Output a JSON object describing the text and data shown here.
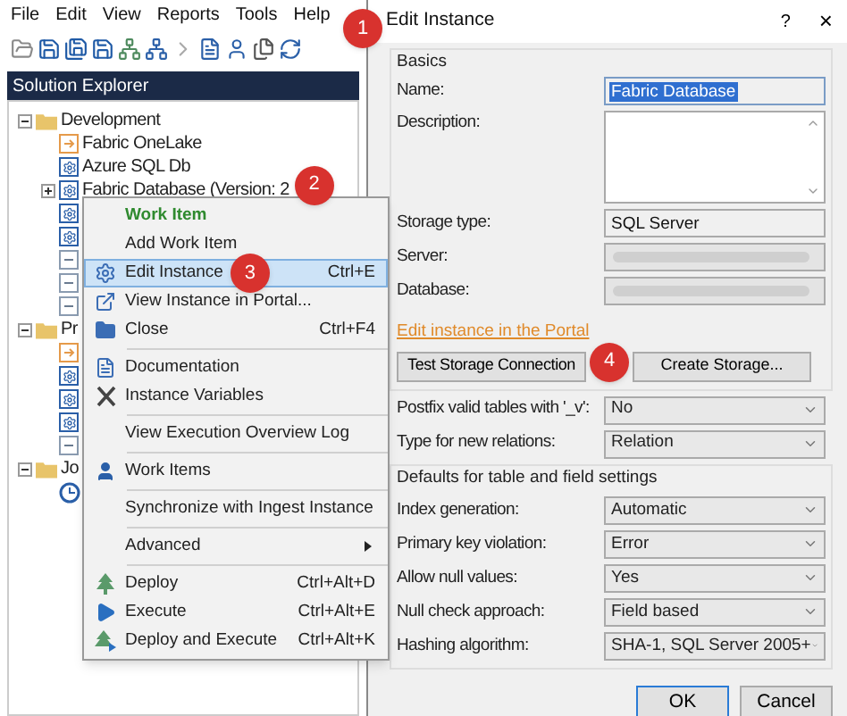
{
  "menubar": [
    "File",
    "Edit",
    "View",
    "Reports",
    "Tools",
    "Help"
  ],
  "solution_explorer": {
    "title": "Solution Explorer",
    "tree": [
      {
        "label": "Development",
        "kind": "folder",
        "expanded": true,
        "children": [
          {
            "label": "Fabric OneLake",
            "kind": "lake"
          },
          {
            "label": "Azure SQL Db",
            "kind": "instance"
          },
          {
            "label": "Fabric Database (Version: 2",
            "kind": "instance",
            "expanded": false,
            "badge": "2"
          },
          {
            "kind": "instance"
          },
          {
            "kind": "instance"
          },
          {
            "kind": "link"
          },
          {
            "kind": "link"
          },
          {
            "kind": "link"
          }
        ]
      },
      {
        "label": "Pr",
        "kind": "folder",
        "expanded": true,
        "children": [
          {
            "kind": "lake"
          },
          {
            "kind": "instance"
          },
          {
            "kind": "instance"
          },
          {
            "kind": "instance"
          },
          {
            "kind": "link"
          }
        ]
      },
      {
        "label": "Jo",
        "kind": "folder",
        "expanded": true,
        "children": [
          {
            "kind": "job"
          }
        ]
      }
    ]
  },
  "context_menu": [
    {
      "kind": "header",
      "label": "Work Item",
      "selected": false
    },
    {
      "kind": "item",
      "label": "Add Work Item",
      "selected": false
    },
    {
      "kind": "item",
      "label": "Edit Instance",
      "shortcut": "Ctrl+E",
      "selected": true,
      "badge": "3"
    },
    {
      "kind": "item",
      "label": "View Instance in Portal...",
      "selected": false
    },
    {
      "kind": "item",
      "label": "Close",
      "shortcut": "Ctrl+F4",
      "selected": false
    },
    {
      "kind": "separator"
    },
    {
      "kind": "item",
      "label": "Documentation",
      "selected": false
    },
    {
      "kind": "item",
      "label": "Instance Variables",
      "selected": false
    },
    {
      "kind": "separator"
    },
    {
      "kind": "item",
      "label": "View Execution Overview Log",
      "selected": false
    },
    {
      "kind": "separator"
    },
    {
      "kind": "item",
      "label": "Work Items",
      "selected": false
    },
    {
      "kind": "separator"
    },
    {
      "kind": "item",
      "label": "Synchronize with Ingest Instance",
      "selected": false
    },
    {
      "kind": "separator"
    },
    {
      "kind": "submenu",
      "label": "Advanced",
      "selected": false
    },
    {
      "kind": "separator"
    },
    {
      "kind": "item",
      "label": "Deploy",
      "shortcut": "Ctrl+Alt+D",
      "selected": false
    },
    {
      "kind": "item",
      "label": "Execute",
      "shortcut": "Ctrl+Alt+E",
      "selected": false
    },
    {
      "kind": "item",
      "label": "Deploy and Execute",
      "shortcut": "Ctrl+Alt+K",
      "selected": false
    }
  ],
  "dialog": {
    "title": "Edit Instance",
    "help": "?",
    "close": "×",
    "badge": "1",
    "basics": {
      "title": "Basics",
      "fields": [
        {
          "kind": "text",
          "label": "Name:",
          "value": "Fabric Database",
          "highlighted": true
        },
        {
          "kind": "textarea",
          "label": "Description:"
        },
        {
          "kind": "text",
          "label": "Storage type:",
          "value": "SQL Server",
          "highlighted": false
        },
        {
          "kind": "blurred",
          "label": "Server:"
        },
        {
          "kind": "blurred",
          "label": "Database:"
        }
      ]
    },
    "portal_link": "Edit instance in the Portal",
    "storage_buttons": [
      "Test Storage Connection",
      "Create Storage..."
    ],
    "storage_badge": "4",
    "fields": [
      {
        "kind": "select",
        "label": "Postfix valid tables with '_v':",
        "value": "No"
      },
      {
        "kind": "select",
        "label": "Type for new relations:",
        "value": "Relation"
      }
    ],
    "defaults": {
      "title": "Defaults for table and field settings",
      "fields": [
        {
          "kind": "select",
          "label": "Index generation:",
          "value": "Automatic"
        },
        {
          "kind": "select",
          "label": "Primary key violation:",
          "value": "Error"
        },
        {
          "kind": "select",
          "label": "Allow null values:",
          "value": "Yes"
        },
        {
          "kind": "select",
          "label": "Null check approach:",
          "value": "Field based"
        },
        {
          "kind": "select",
          "label": "Hashing algorithm:",
          "value": "SHA-1, SQL Server 2005+"
        }
      ]
    },
    "buttons": [
      "OK",
      "Cancel"
    ]
  }
}
